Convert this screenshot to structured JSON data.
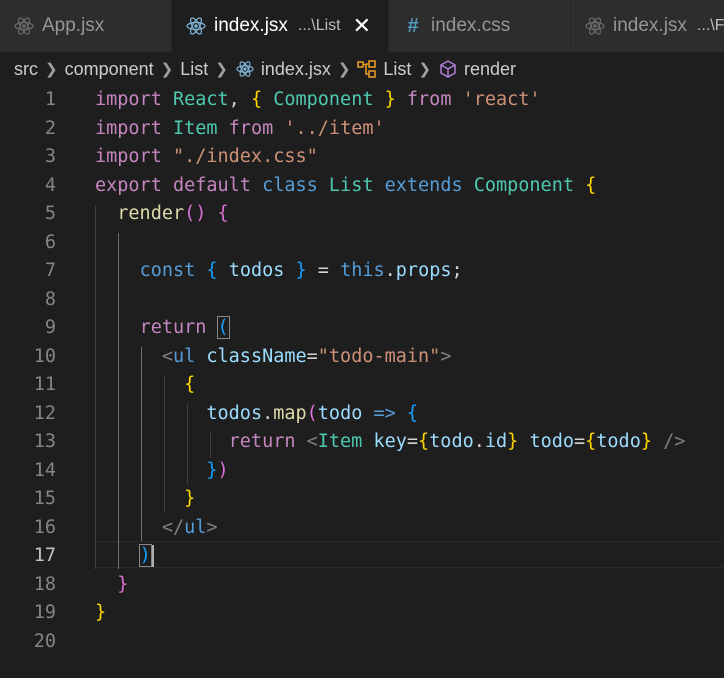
{
  "tabs": [
    {
      "label": "App.jsx",
      "icon": "react-icon"
    },
    {
      "label": "index.jsx",
      "path": "...\\List",
      "icon": "react-icon",
      "active": true
    },
    {
      "label": "index.css",
      "icon": "hash-icon"
    },
    {
      "label": "index.jsx",
      "path": "...\\F",
      "icon": "react-icon"
    }
  ],
  "breadcrumb": [
    "src",
    "component",
    "List",
    "index.jsx",
    "List",
    "render"
  ],
  "editor": {
    "current_line": 17,
    "lines": [
      [
        [
          "kw",
          "import"
        ],
        [
          "pl",
          " "
        ],
        [
          "ty",
          "React"
        ],
        [
          "pl",
          ", "
        ],
        [
          "b1",
          "{"
        ],
        [
          "pl",
          " "
        ],
        [
          "ty",
          "Component"
        ],
        [
          "pl",
          " "
        ],
        [
          "b1",
          "}"
        ],
        [
          "pl",
          " "
        ],
        [
          "kw",
          "from"
        ],
        [
          "pl",
          " "
        ],
        [
          "s",
          "'react'"
        ]
      ],
      [
        [
          "kw",
          "import"
        ],
        [
          "pl",
          " "
        ],
        [
          "ty",
          "Item"
        ],
        [
          "pl",
          " "
        ],
        [
          "kw",
          "from"
        ],
        [
          "pl",
          " "
        ],
        [
          "s",
          "'../item'"
        ]
      ],
      [
        [
          "kw",
          "import"
        ],
        [
          "pl",
          " "
        ],
        [
          "s",
          "\"./index.css\""
        ]
      ],
      [
        [
          "kw",
          "export"
        ],
        [
          "pl",
          " "
        ],
        [
          "kw",
          "default"
        ],
        [
          "pl",
          " "
        ],
        [
          "st",
          "class"
        ],
        [
          "pl",
          " "
        ],
        [
          "ty",
          "List"
        ],
        [
          "pl",
          " "
        ],
        [
          "st",
          "extends"
        ],
        [
          "pl",
          " "
        ],
        [
          "ty",
          "Component"
        ],
        [
          "pl",
          " "
        ],
        [
          "b1",
          "{"
        ]
      ],
      [
        [
          "pl",
          "  "
        ],
        [
          "fn",
          "render"
        ],
        [
          "b2",
          "()"
        ],
        [
          "pl",
          " "
        ],
        [
          "b2",
          "{"
        ]
      ],
      [],
      [
        [
          "pl",
          "    "
        ],
        [
          "st",
          "const"
        ],
        [
          "pl",
          " "
        ],
        [
          "b3",
          "{"
        ],
        [
          "pl",
          " "
        ],
        [
          "va",
          "todos"
        ],
        [
          "pl",
          " "
        ],
        [
          "b3",
          "}"
        ],
        [
          "pl",
          " = "
        ],
        [
          "st",
          "this"
        ],
        [
          "pl",
          "."
        ],
        [
          "va",
          "props"
        ],
        [
          "pl",
          ";"
        ]
      ],
      [],
      [
        [
          "pl",
          "    "
        ],
        [
          "kw",
          "return"
        ],
        [
          "pl",
          " "
        ],
        [
          "b3",
          "("
        ]
      ],
      [
        [
          "pl",
          "      "
        ],
        [
          "tg",
          "<"
        ],
        [
          "tn",
          "ul"
        ],
        [
          "pl",
          " "
        ],
        [
          "at",
          "className"
        ],
        [
          "pl",
          "="
        ],
        [
          "s",
          "\"todo-main\""
        ],
        [
          "tg",
          ">"
        ]
      ],
      [
        [
          "pl",
          "        "
        ],
        [
          "b1",
          "{"
        ]
      ],
      [
        [
          "pl",
          "          "
        ],
        [
          "va",
          "todos"
        ],
        [
          "pl",
          "."
        ],
        [
          "fn",
          "map"
        ],
        [
          "b2",
          "("
        ],
        [
          "va",
          "todo"
        ],
        [
          "pl",
          " "
        ],
        [
          "st",
          "=>"
        ],
        [
          "pl",
          " "
        ],
        [
          "b3",
          "{"
        ]
      ],
      [
        [
          "pl",
          "            "
        ],
        [
          "kw",
          "return"
        ],
        [
          "pl",
          " "
        ],
        [
          "tg",
          "<"
        ],
        [
          "ty",
          "Item"
        ],
        [
          "pl",
          " "
        ],
        [
          "at",
          "key"
        ],
        [
          "pl",
          "="
        ],
        [
          "b1",
          "{"
        ],
        [
          "va",
          "todo"
        ],
        [
          "pl",
          "."
        ],
        [
          "va",
          "id"
        ],
        [
          "b1",
          "}"
        ],
        [
          "pl",
          " "
        ],
        [
          "at",
          "todo"
        ],
        [
          "pl",
          "="
        ],
        [
          "b1",
          "{"
        ],
        [
          "va",
          "todo"
        ],
        [
          "b1",
          "}"
        ],
        [
          "pl",
          " "
        ],
        [
          "tg",
          "/>"
        ]
      ],
      [
        [
          "pl",
          "          "
        ],
        [
          "b3",
          "}"
        ],
        [
          "b2",
          ")"
        ]
      ],
      [
        [
          "pl",
          "        "
        ],
        [
          "b1",
          "}"
        ]
      ],
      [
        [
          "pl",
          "      "
        ],
        [
          "tg",
          "</"
        ],
        [
          "tn",
          "ul"
        ],
        [
          "tg",
          ">"
        ]
      ],
      [
        [
          "pl",
          "    "
        ],
        [
          "b3",
          ")"
        ]
      ],
      [
        [
          "pl",
          "  "
        ],
        [
          "b2",
          "}"
        ]
      ],
      [
        [
          "b1",
          "}"
        ]
      ],
      []
    ]
  }
}
